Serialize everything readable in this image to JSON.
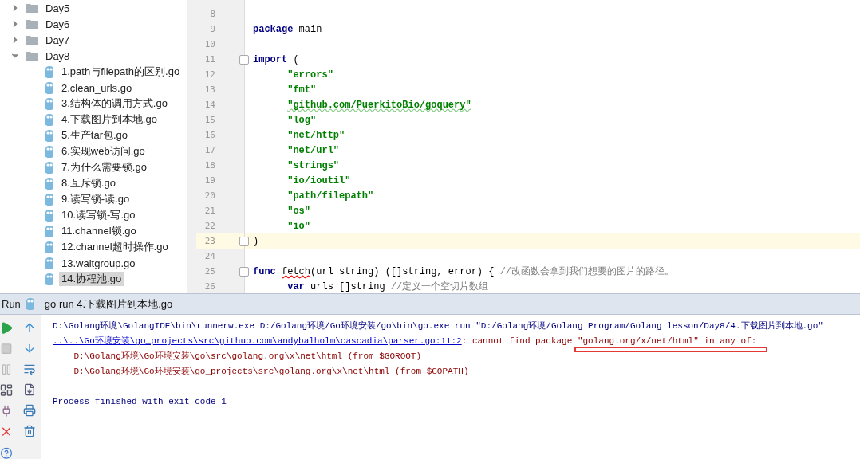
{
  "project_tree": [
    {
      "label": "Day5",
      "kind": "folder",
      "expanded": false
    },
    {
      "label": "Day6",
      "kind": "folder",
      "expanded": false
    },
    {
      "label": "Day7",
      "kind": "folder",
      "expanded": false
    },
    {
      "label": "Day8",
      "kind": "folder",
      "expanded": true,
      "children": [
        {
          "label": "1.path与filepath的区别.go",
          "kind": "file",
          "selected": false
        },
        {
          "label": "2.clean_urls.go",
          "kind": "file",
          "selected": false
        },
        {
          "label": "3.结构体的调用方式.go",
          "kind": "file",
          "selected": false
        },
        {
          "label": "4.下载图片到本地.go",
          "kind": "file",
          "selected": false
        },
        {
          "label": "5.生产tar包.go",
          "kind": "file",
          "selected": false
        },
        {
          "label": "6.实现web访问.go",
          "kind": "file",
          "selected": false
        },
        {
          "label": "7.为什么需要锁.go",
          "kind": "file",
          "selected": false
        },
        {
          "label": "8.互斥锁.go",
          "kind": "file",
          "selected": false
        },
        {
          "label": "9.读写锁-读.go",
          "kind": "file",
          "selected": false
        },
        {
          "label": "10.读写锁-写.go",
          "kind": "file",
          "selected": false
        },
        {
          "label": "11.channel锁.go",
          "kind": "file",
          "selected": false
        },
        {
          "label": "12.channel超时操作.go",
          "kind": "file",
          "selected": false
        },
        {
          "label": "13.waitgroup.go",
          "kind": "file",
          "selected": false
        },
        {
          "label": "14.协程池.go",
          "kind": "file",
          "selected": true
        }
      ]
    }
  ],
  "editor": {
    "lines": [
      {
        "number": "8",
        "current": false,
        "fold": false
      },
      {
        "number": "9",
        "current": false,
        "fold": false,
        "tokens": [
          {
            "kind": "keyword",
            "text": "package"
          },
          {
            "kind": "plain",
            "text": " main"
          }
        ]
      },
      {
        "number": "10",
        "current": false,
        "fold": false
      },
      {
        "number": "11",
        "current": false,
        "fold": true,
        "tokens": [
          {
            "kind": "keyword",
            "text": "import"
          },
          {
            "kind": "plain",
            "text": " ("
          }
        ]
      },
      {
        "number": "12",
        "current": false,
        "fold": false,
        "tokens": [
          {
            "kind": "string",
            "text": "\t\"errors\""
          }
        ]
      },
      {
        "number": "13",
        "current": false,
        "fold": false,
        "tokens": [
          {
            "kind": "string",
            "text": "\t\"fmt\""
          }
        ]
      },
      {
        "number": "14",
        "current": false,
        "fold": false,
        "tokens": [
          {
            "kind": "string",
            "text": "\t\"github.com/PuerkitoBio/goquery\"",
            "squiggle": true
          }
        ]
      },
      {
        "number": "15",
        "current": false,
        "fold": false,
        "tokens": [
          {
            "kind": "string",
            "text": "\t\"log\""
          }
        ]
      },
      {
        "number": "16",
        "current": false,
        "fold": false,
        "tokens": [
          {
            "kind": "string",
            "text": "\t\"net/http\""
          }
        ]
      },
      {
        "number": "17",
        "current": false,
        "fold": false,
        "tokens": [
          {
            "kind": "string",
            "text": "\t\"net/url\""
          }
        ]
      },
      {
        "number": "18",
        "current": false,
        "fold": false,
        "tokens": [
          {
            "kind": "string",
            "text": "\t\"strings\""
          }
        ]
      },
      {
        "number": "19",
        "current": false,
        "fold": false,
        "tokens": [
          {
            "kind": "string",
            "text": "\t\"io/ioutil\""
          }
        ]
      },
      {
        "number": "20",
        "current": false,
        "fold": false,
        "tokens": [
          {
            "kind": "string",
            "text": "\t\"path/filepath\""
          }
        ]
      },
      {
        "number": "21",
        "current": false,
        "fold": false,
        "tokens": [
          {
            "kind": "string",
            "text": "\t\"os\""
          }
        ]
      },
      {
        "number": "22",
        "current": false,
        "fold": false,
        "tokens": [
          {
            "kind": "string",
            "text": "\t\"io\""
          }
        ]
      },
      {
        "number": "23",
        "current": true,
        "fold": true,
        "tokens": [
          {
            "kind": "plain",
            "text": ")"
          }
        ]
      },
      {
        "number": "24",
        "current": false,
        "fold": false
      },
      {
        "number": "25",
        "current": false,
        "fold": true,
        "tokens": [
          {
            "kind": "keyword",
            "text": "func "
          },
          {
            "kind": "plain",
            "text": "fetch",
            "squiggle": true
          },
          {
            "kind": "plain",
            "text": "(url string) ([]string, error) { "
          },
          {
            "kind": "comment",
            "text": "//改函数会拿到我们想要的图片的路径。"
          }
        ]
      },
      {
        "number": "26",
        "current": false,
        "fold": false,
        "tokens": [
          {
            "kind": "keyword",
            "text": "\tvar"
          },
          {
            "kind": "plain",
            "text": " urls []string "
          },
          {
            "kind": "comment",
            "text": "//定义一个空切片数组"
          }
        ]
      }
    ]
  },
  "run_panel": {
    "title": "Run",
    "tab": "go run 4.下载图片到本地.go",
    "console": [
      {
        "segments": [
          {
            "kind": "command",
            "text": "D:\\Golang环境\\GolangIDE\\bin\\runnerw.exe D:/Golang环境/Go环境安装/go\\bin\\go.exe run \"D:/Golang环境/Golang Program/Golang lesson/Day8/4.下载图片到本地.go\""
          }
        ]
      },
      {
        "segments": [
          {
            "kind": "link",
            "text": "..\\..\\Go环境安装\\go_projects\\src\\github.com\\andybalholm\\cascadia\\parser.go:11:2"
          },
          {
            "kind": "error",
            "text": ": cannot find package "
          },
          {
            "kind": "error",
            "text": "\"golang.org/x/net/html\" in any of:",
            "highlight": true
          }
        ]
      },
      {
        "segments": [
          {
            "kind": "error",
            "text": "\tD:\\Golang环境\\Go环境安装\\go\\src\\golang.org\\x\\net\\html (from $GOROOT)"
          }
        ]
      },
      {
        "segments": [
          {
            "kind": "error",
            "text": "\tD:\\Golang环境\\Go环境安装\\go_projects\\src\\golang.org\\x\\net\\html (from $GOPATH)"
          }
        ]
      },
      {
        "kind": "blank"
      },
      {
        "segments": [
          {
            "kind": "command",
            "text": "Process finished with exit code 1"
          }
        ]
      }
    ]
  }
}
